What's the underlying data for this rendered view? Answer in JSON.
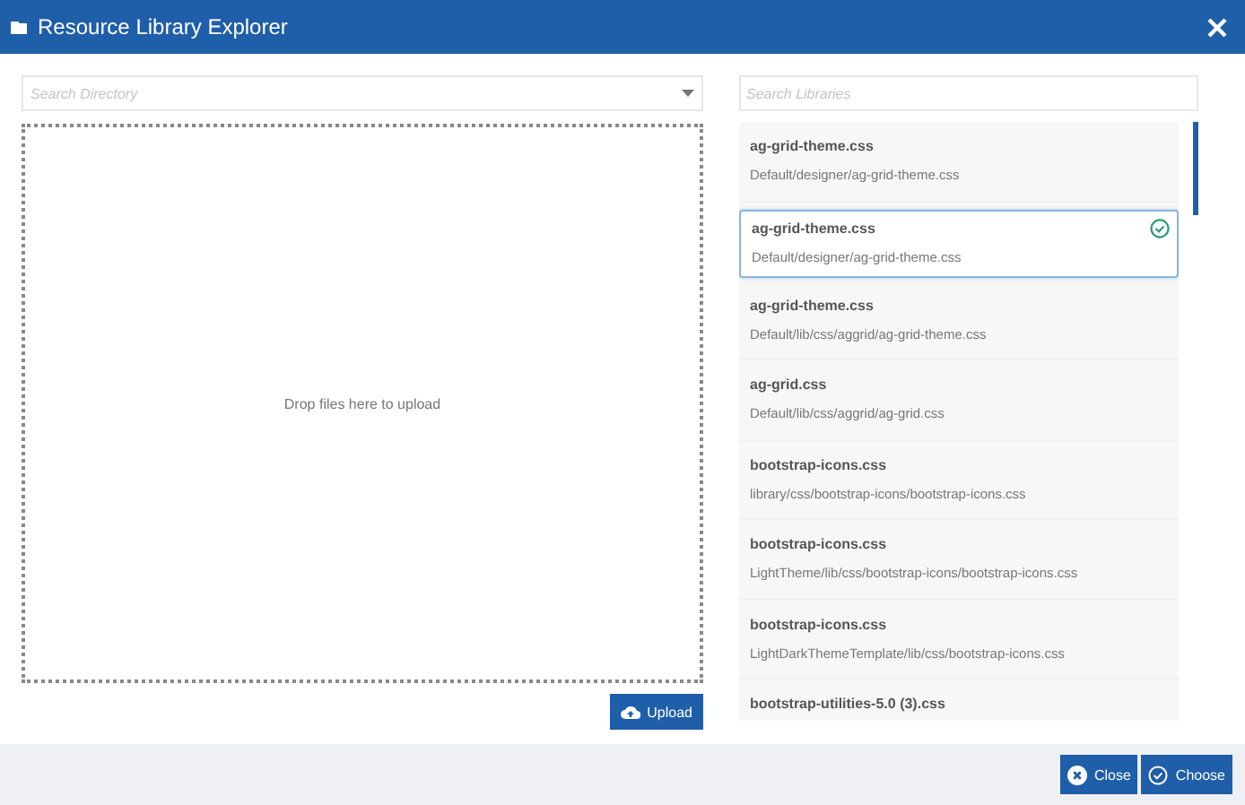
{
  "window": {
    "title": "Resource Library Explorer"
  },
  "directory": {
    "placeholder": "Search Directory"
  },
  "dropzone": {
    "text": "Drop files here to upload"
  },
  "upload_button": {
    "label": "Upload"
  },
  "library_search": {
    "placeholder": "Search Libraries"
  },
  "libraries": [
    {
      "name": "ag-grid-theme.css",
      "path": "Default/designer/ag-grid-theme.css",
      "selected": false
    },
    {
      "name": "ag-grid-theme.css",
      "path": "Default/designer/ag-grid-theme.css",
      "selected": true
    },
    {
      "name": "ag-grid-theme.css",
      "path": "Default/lib/css/aggrid/ag-grid-theme.css",
      "selected": false
    },
    {
      "name": "ag-grid.css",
      "path": "Default/lib/css/aggrid/ag-grid.css",
      "selected": false
    },
    {
      "name": "bootstrap-icons.css",
      "path": "library/css/bootstrap-icons/bootstrap-icons.css",
      "selected": false
    },
    {
      "name": "bootstrap-icons.css",
      "path": "LightTheme/lib/css/bootstrap-icons/bootstrap-icons.css",
      "selected": false
    },
    {
      "name": "bootstrap-icons.css",
      "path": "LightDarkThemeTemplate/lib/css/bootstrap-icons.css",
      "selected": false
    },
    {
      "name": "bootstrap-utilities-5.0 (3).css",
      "selected": false
    }
  ],
  "footer": {
    "buttons": [
      {
        "kind": "close",
        "label": "Close"
      },
      {
        "kind": "choose",
        "label": "Choose"
      }
    ]
  }
}
